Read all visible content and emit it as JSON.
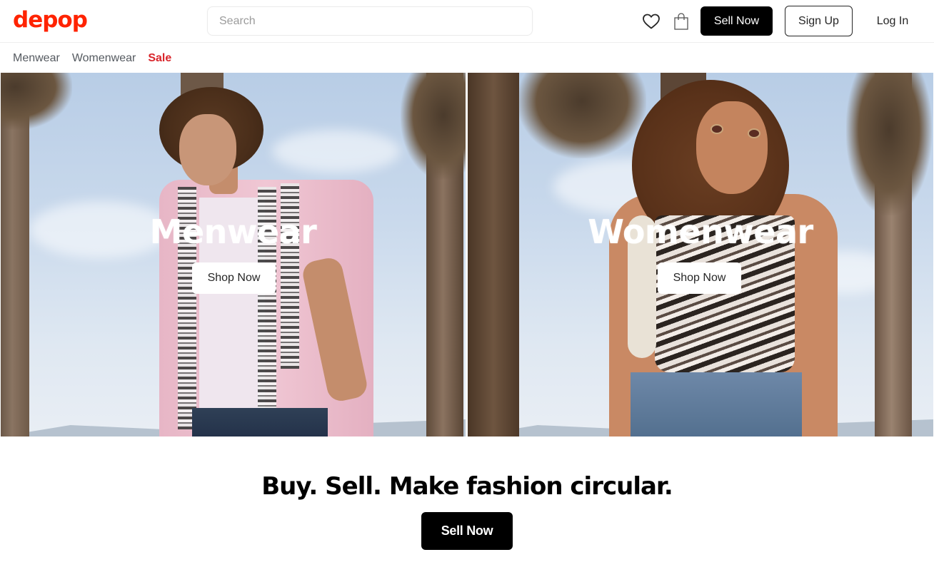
{
  "header": {
    "logo": "depop",
    "search_placeholder": "Search",
    "search_value": "",
    "icons": [
      "heart-icon",
      "shopping-bag-icon"
    ],
    "sell_now_label": "Sell Now",
    "sign_up_label": "Sign Up",
    "log_in_label": "Log In"
  },
  "category_nav": {
    "items": [
      {
        "label": "Menwear"
      },
      {
        "label": "Womenwear"
      },
      {
        "label": "Sale"
      }
    ]
  },
  "hero": {
    "panels": [
      {
        "title": "Menwear",
        "button_label": "Shop Now",
        "image": "man-in-pink-shirt-palm-trees"
      },
      {
        "title": "Womenwear",
        "button_label": "Shop Now",
        "image": "woman-in-zebra-top-palm-trees"
      }
    ]
  },
  "promo": {
    "tagline": "Buy. Sell. Make fashion circular.",
    "button_label": "Sell Now"
  },
  "colors": {
    "brand": "#ff2300",
    "sale": "#d9262c",
    "primary_button": "#000000"
  }
}
